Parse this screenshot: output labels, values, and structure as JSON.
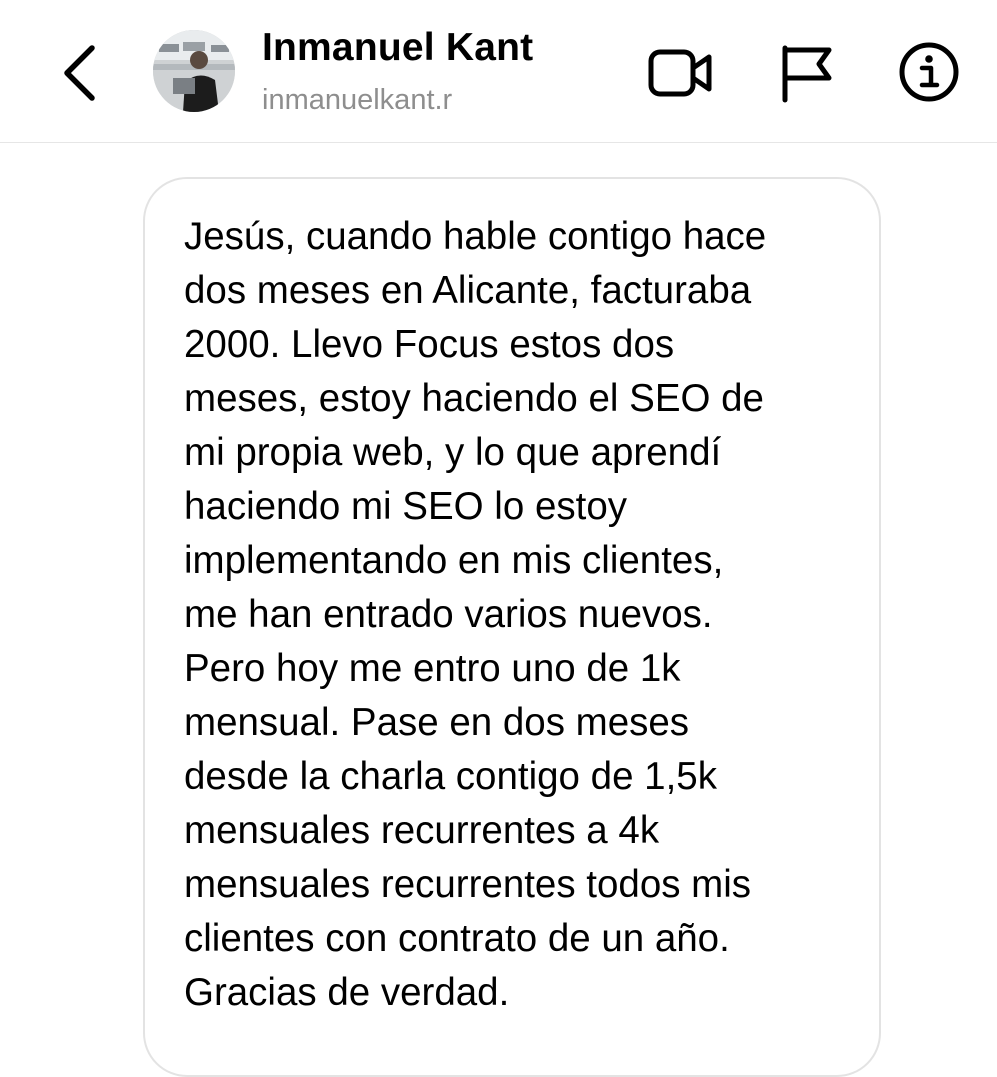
{
  "header": {
    "name": "Inmanuel Kant",
    "handle": "inmanuelkant.r",
    "icons": {
      "back": "chevron-left-icon",
      "video": "video-camera-icon",
      "flag": "flag-icon",
      "info": "info-icon"
    }
  },
  "message": {
    "lines": [
      "Jesús, cuando hable contigo hace",
      "dos meses en Alicante, facturaba",
      "2000. Llevo Focus estos dos",
      "meses, estoy haciendo el SEO de",
      "mi propia web, y lo que aprendí",
      "haciendo mi SEO lo estoy",
      "implementando en mis clientes,",
      "me han entrado varios nuevos.",
      "Pero hoy me entro uno de 1k",
      "mensual. Pase en dos meses",
      "desde la charla contigo de 1,5k",
      "mensuales recurrentes a 4k",
      "mensuales recurrentes todos mis",
      "clientes con contrato de un año.",
      "Gracias de verdad."
    ]
  }
}
